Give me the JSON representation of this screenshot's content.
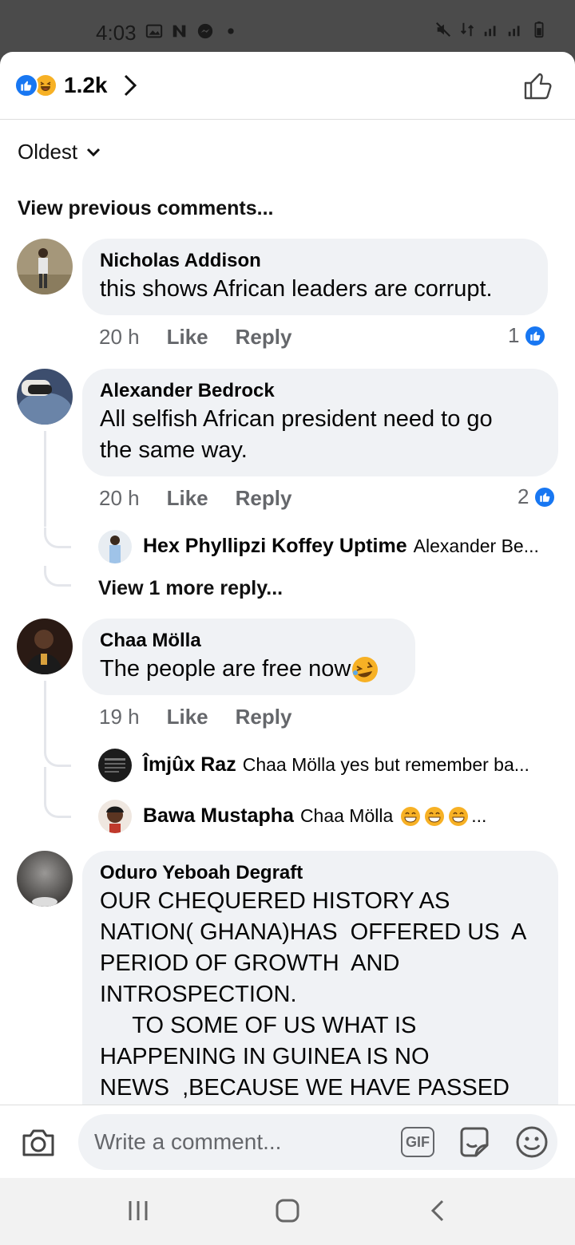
{
  "status_bar": {
    "time": "4:03"
  },
  "header": {
    "reaction_count": "1.2k"
  },
  "sort": {
    "label": "Oldest"
  },
  "view_previous": "View previous comments...",
  "comments": [
    {
      "name": "Nicholas Addison",
      "text": "this shows African leaders are corrupt.",
      "time": "20 h",
      "like": "Like",
      "reply": "Reply",
      "likes": "1"
    },
    {
      "name": "Alexander Bedrock",
      "text": "All selfish African president need to go\nthe same way.",
      "time": "20 h",
      "like": "Like",
      "reply": "Reply",
      "likes": "2",
      "replies": [
        {
          "name": "Hex Phyllipzi Koffey Uptime",
          "snippet": "Alexander Be..."
        }
      ],
      "more_replies": "View 1 more reply..."
    },
    {
      "name": "Chaa Mölla",
      "text": "The people are free now",
      "time": "19 h",
      "like": "Like",
      "reply": "Reply",
      "replies": [
        {
          "name": "Îmjûx Raz",
          "snippet": "Chaa Mölla yes but remember ba..."
        },
        {
          "name": "Bawa Mustapha",
          "snippet": "Chaa Mölla",
          "ellipsis": "..."
        }
      ]
    },
    {
      "name": "Oduro Yeboah Degraft",
      "text": "OUR CHEQUERED HISTORY AS\nNATION( GHANA)HAS  OFFERED US  A\nPERIOD OF GROWTH  AND\nINTROSPECTION.\n     TO SOME OF US WHAT IS\nHAPPENING IN GUINEA IS NO\nNEWS  ,BECAUSE WE HAVE PASSED"
    }
  ],
  "composer": {
    "placeholder": "Write a comment...",
    "gif_label": "GIF"
  },
  "colors": {
    "accent": "#1877f2",
    "bubble": "#f0f2f5",
    "meta": "#65676b",
    "haha": "#f7b125"
  }
}
